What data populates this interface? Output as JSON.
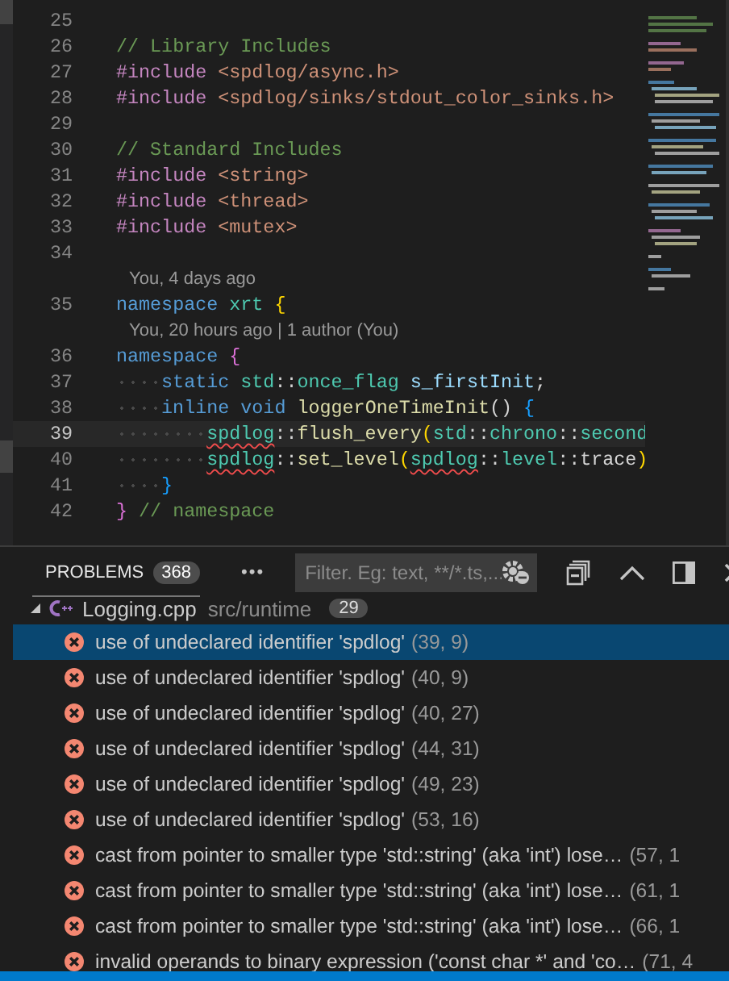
{
  "editor": {
    "lines": [
      {
        "number": "25",
        "current": false
      },
      {
        "number": "26",
        "current": false,
        "words": [
          [
            {
              "text": "//",
              "kind": "comment"
            }
          ],
          [
            {
              "text": "Library",
              "kind": "comment"
            }
          ],
          [
            {
              "text": "Includes",
              "kind": "comment"
            }
          ]
        ]
      },
      {
        "number": "27",
        "current": false,
        "words": [
          [
            {
              "text": "#include",
              "kind": "directive"
            }
          ],
          [
            {
              "text": "<spdlog/async.h>",
              "kind": "path"
            }
          ]
        ]
      },
      {
        "number": "28",
        "current": false,
        "words": [
          [
            {
              "text": "#include",
              "kind": "directive"
            }
          ],
          [
            {
              "text": "<spdlog/sinks/stdout_color_sinks.h>",
              "kind": "path"
            }
          ]
        ]
      },
      {
        "number": "29",
        "current": false
      },
      {
        "number": "30",
        "current": false,
        "words": [
          [
            {
              "text": "//",
              "kind": "comment"
            }
          ],
          [
            {
              "text": "Standard",
              "kind": "comment"
            }
          ],
          [
            {
              "text": "Includes",
              "kind": "comment"
            }
          ]
        ]
      },
      {
        "number": "31",
        "current": false,
        "words": [
          [
            {
              "text": "#include",
              "kind": "directive"
            }
          ],
          [
            {
              "text": "<string>",
              "kind": "path"
            }
          ]
        ]
      },
      {
        "number": "32",
        "current": false,
        "words": [
          [
            {
              "text": "#include",
              "kind": "directive"
            }
          ],
          [
            {
              "text": "<thread>",
              "kind": "path"
            }
          ]
        ]
      },
      {
        "number": "33",
        "current": false,
        "words": [
          [
            {
              "text": "#include",
              "kind": "directive"
            }
          ],
          [
            {
              "text": "<mutex>",
              "kind": "path"
            }
          ]
        ]
      },
      {
        "number": "34",
        "current": false
      },
      {
        "lens": "You, 4 days ago"
      },
      {
        "number": "35",
        "current": false,
        "words": [
          [
            {
              "text": "namespace",
              "kind": "keyword"
            }
          ],
          [
            {
              "text": "xrt",
              "kind": "type"
            }
          ],
          [
            {
              "text": "{",
              "kind": "bracket1"
            }
          ]
        ]
      },
      {
        "lens": "You, 20 hours ago | 1 author (You)"
      },
      {
        "number": "36",
        "current": false,
        "words": [
          [
            {
              "text": "namespace",
              "kind": "keyword"
            }
          ],
          [
            {
              "text": "{",
              "kind": "bracket2"
            }
          ]
        ],
        "children": [
          {
            "number": "37",
            "current": false,
            "words": [
              [
                {
                  "text": "static",
                  "kind": "keyword"
                }
              ],
              [
                {
                  "text": "std",
                  "kind": "type"
                },
                {
                  "text": "::",
                  "kind": "plain"
                },
                {
                  "text": "once_flag",
                  "kind": "type"
                }
              ],
              [
                {
                  "text": "s_firstInit",
                  "kind": "var"
                },
                {
                  "text": ";",
                  "kind": "plain"
                }
              ]
            ]
          },
          {
            "number": "38",
            "current": false,
            "words": [
              [
                {
                  "text": "inline",
                  "kind": "keyword"
                }
              ],
              [
                {
                  "text": "void",
                  "kind": "keyword"
                }
              ],
              [
                {
                  "text": "loggerOneTimeInit",
                  "kind": "func"
                },
                {
                  "text": "()",
                  "kind": "plain"
                }
              ],
              [
                {
                  "text": "{",
                  "kind": "bracket3"
                }
              ]
            ],
            "children": [
              {
                "number": "39",
                "current": true,
                "words": [
                  [
                    {
                      "text": "spdlog",
                      "kind": "type",
                      "error": true
                    },
                    {
                      "text": "::",
                      "kind": "plain"
                    },
                    {
                      "text": "flush_every",
                      "kind": "func"
                    },
                    {
                      "text": "(",
                      "kind": "bracket1"
                    },
                    {
                      "text": "std",
                      "kind": "type"
                    },
                    {
                      "text": "::",
                      "kind": "plain"
                    },
                    {
                      "text": "chrono",
                      "kind": "type"
                    },
                    {
                      "text": "::",
                      "kind": "plain"
                    },
                    {
                      "text": "second",
                      "kind": "type"
                    }
                  ]
                ]
              },
              {
                "number": "40",
                "current": false,
                "words": [
                  [
                    {
                      "text": "spdlog",
                      "kind": "type",
                      "error": true
                    },
                    {
                      "text": "::",
                      "kind": "plain"
                    },
                    {
                      "text": "set_level",
                      "kind": "func"
                    },
                    {
                      "text": "(",
                      "kind": "bracket1"
                    },
                    {
                      "text": "spdlog",
                      "kind": "type",
                      "error": true
                    },
                    {
                      "text": "::",
                      "kind": "plain"
                    },
                    {
                      "text": "level",
                      "kind": "type"
                    },
                    {
                      "text": "::",
                      "kind": "plain"
                    },
                    {
                      "text": "trace",
                      "kind": "plain"
                    },
                    {
                      "text": ")",
                      "kind": "bracket1"
                    }
                  ]
                ]
              }
            ]
          },
          {
            "number": "41",
            "current": false,
            "words": [
              [
                {
                  "text": "}",
                  "kind": "bracket3"
                }
              ]
            ]
          }
        ]
      },
      {
        "number": "42",
        "current": false,
        "words": [
          [
            {
              "text": "}",
              "kind": "bracket2"
            }
          ],
          [
            {
              "text": "//",
              "kind": "comment"
            }
          ],
          [
            {
              "text": "namespace",
              "kind": "comment"
            }
          ]
        ]
      }
    ]
  },
  "panel": {
    "tabs": [
      {
        "label": "PROBLEMS",
        "count": "368",
        "selected": true
      }
    ],
    "more": "•••",
    "filter": {
      "placeholder": "Filter. Eg: text, **/*.ts,..."
    },
    "file": {
      "name": "Logging.cpp",
      "path": "src/runtime",
      "count": "29",
      "expanded": true
    },
    "problems": [
      {
        "message": "use of undeclared identifier 'spdlog'",
        "location": "(39, 9)",
        "selected": true
      },
      {
        "message": "use of undeclared identifier 'spdlog'",
        "location": "(40, 9)",
        "selected": false
      },
      {
        "message": "use of undeclared identifier 'spdlog'",
        "location": "(40, 27)",
        "selected": false
      },
      {
        "message": "use of undeclared identifier 'spdlog'",
        "location": "(44, 31)",
        "selected": false
      },
      {
        "message": "use of undeclared identifier 'spdlog'",
        "location": "(49, 23)",
        "selected": false
      },
      {
        "message": "use of undeclared identifier 'spdlog'",
        "location": "(53, 16)",
        "selected": false
      },
      {
        "message": "cast from pointer to smaller type 'std::string' (aka 'int') lose…",
        "location": "(57, 1",
        "selected": false
      },
      {
        "message": "cast from pointer to smaller type 'std::string' (aka 'int') lose…",
        "location": "(61, 1",
        "selected": false
      },
      {
        "message": "cast from pointer to smaller type 'std::string' (aka 'int') lose…",
        "location": "(66, 1",
        "selected": false
      },
      {
        "message": "invalid operands to binary expression ('const char *' and 'co…",
        "location": "(71, 4",
        "selected": false
      }
    ]
  }
}
